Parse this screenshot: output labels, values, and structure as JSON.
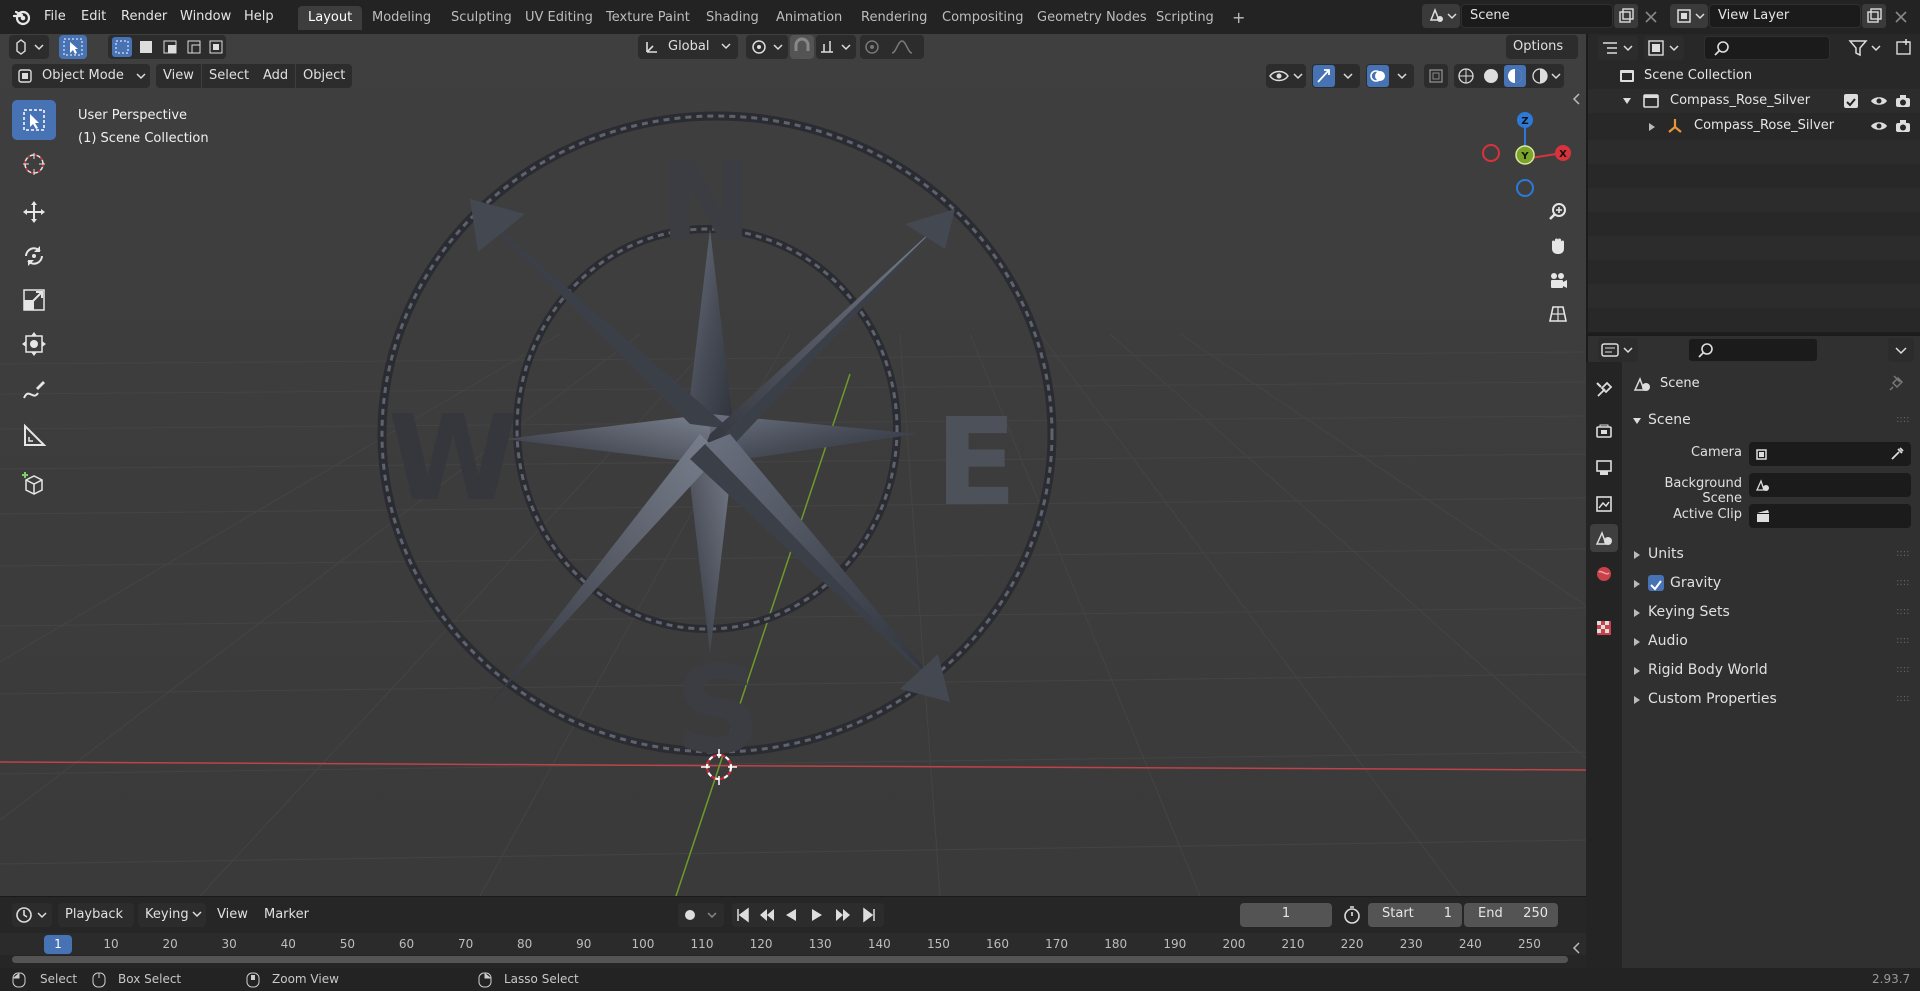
{
  "topbar": {
    "menu": [
      "File",
      "Edit",
      "Render",
      "Window",
      "Help"
    ],
    "workspaces": [
      "Layout",
      "Modeling",
      "Sculpting",
      "UV Editing",
      "Texture Paint",
      "Shading",
      "Animation",
      "Rendering",
      "Compositing",
      "Geometry Nodes",
      "Scripting"
    ],
    "active_workspace": "Layout",
    "scene_name": "Scene",
    "view_layer": "View Layer",
    "add_workspace": "+"
  },
  "viewport_header": {
    "transform_orientation": "Global",
    "options": "Options",
    "mode": "Object Mode",
    "menus": [
      "View",
      "Select",
      "Add",
      "Object"
    ]
  },
  "viewport": {
    "perspective_label": "User Perspective",
    "collection_label": "(1) Scene Collection",
    "compass_letters": [
      "N",
      "E",
      "S",
      "W"
    ],
    "gizmo_axes": [
      "Z",
      "X",
      "Y"
    ],
    "colors": {
      "x_axis": "#d8333d",
      "y_axis": "#7ba42b",
      "z_axis": "#2c7ad8",
      "active_tool": "#4772b3"
    }
  },
  "timeline": {
    "menus": [
      "Playback",
      "Keying",
      "View",
      "Marker"
    ],
    "current_frame": "1",
    "start_label": "Start",
    "start_value": "1",
    "end_label": "End",
    "end_value": "250",
    "frame_ticks": [
      "1",
      "10",
      "20",
      "30",
      "40",
      "50",
      "60",
      "70",
      "80",
      "90",
      "100",
      "110",
      "120",
      "130",
      "140",
      "150",
      "160",
      "170",
      "180",
      "190",
      "200",
      "210",
      "220",
      "230",
      "240",
      "250"
    ]
  },
  "statusbar": {
    "select": "Select",
    "box_select": "Box Select",
    "zoom_view": "Zoom View",
    "lasso_select": "Lasso Select",
    "version": "2.93.7"
  },
  "outliner": {
    "root": "Scene Collection",
    "collection": "Compass_Rose_Silver",
    "object": "Compass_Rose_Silver"
  },
  "properties": {
    "context": "Scene",
    "panel_title": "Scene",
    "camera_label": "Camera",
    "background_scene_label": "Background Scene",
    "active_clip_label": "Active Clip",
    "subpanels": [
      "Units",
      "Gravity",
      "Keying Sets",
      "Audio",
      "Rigid Body World",
      "Custom Properties"
    ],
    "gravity_checked": true
  }
}
